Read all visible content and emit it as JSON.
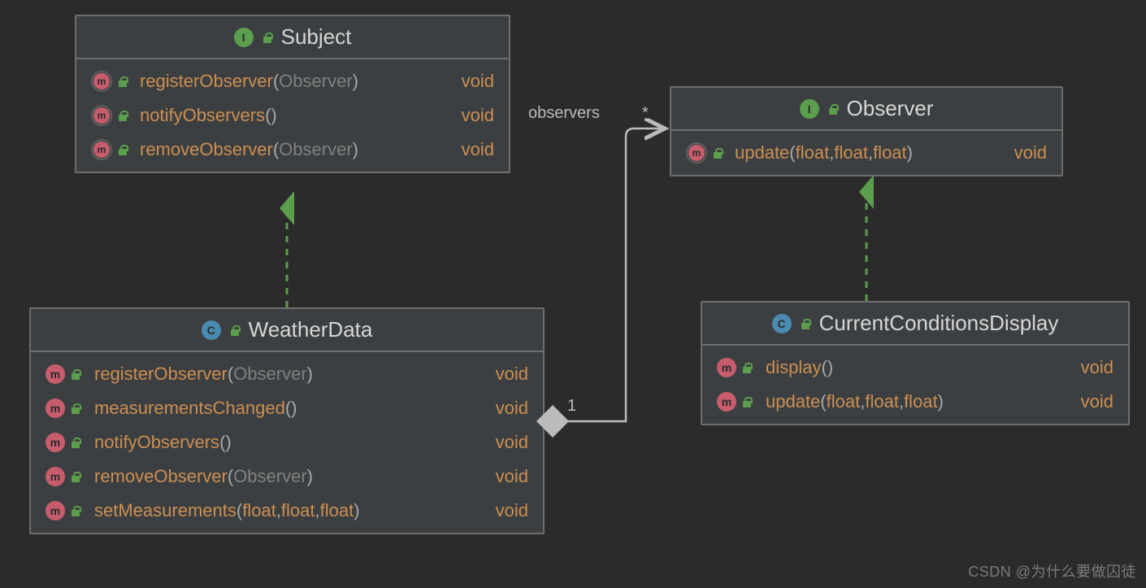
{
  "colors": {
    "bg": "#2b2b2b",
    "box": "#3c3f41",
    "border": "#6e6e6e",
    "name": "#cc8f52",
    "paramObj": "#808080",
    "ret": "#cc8f52",
    "interfaceIcon": "#5b9e4d",
    "classIcon": "#4a8ab0",
    "methodIcon": "#c75d6c",
    "arrowGreen": "#5b9e4d",
    "edgeGray": "#bbbbbb"
  },
  "subject": {
    "title": "Subject",
    "kind": "interface",
    "methods": [
      {
        "name": "registerObserver",
        "params": [
          {
            "t": "Observer",
            "style": "obj"
          }
        ],
        "ret": "void",
        "abstract": true
      },
      {
        "name": "notifyObservers",
        "params": [],
        "ret": "void",
        "abstract": true
      },
      {
        "name": "removeObserver",
        "params": [
          {
            "t": "Observer",
            "style": "obj"
          }
        ],
        "ret": "void",
        "abstract": true
      }
    ]
  },
  "observer": {
    "title": "Observer",
    "kind": "interface",
    "methods": [
      {
        "name": "update",
        "params": [
          {
            "t": "float",
            "style": "prim"
          },
          {
            "t": "float",
            "style": "prim"
          },
          {
            "t": "float",
            "style": "prim"
          }
        ],
        "ret": "void",
        "abstract": true
      }
    ]
  },
  "weatherData": {
    "title": "WeatherData",
    "kind": "class",
    "methods": [
      {
        "name": "registerObserver",
        "params": [
          {
            "t": "Observer",
            "style": "obj"
          }
        ],
        "ret": "void",
        "abstract": false
      },
      {
        "name": "measurementsChanged",
        "params": [],
        "ret": "void",
        "abstract": false
      },
      {
        "name": "notifyObservers",
        "params": [],
        "ret": "void",
        "abstract": false
      },
      {
        "name": "removeObserver",
        "params": [
          {
            "t": "Observer",
            "style": "obj"
          }
        ],
        "ret": "void",
        "abstract": false
      },
      {
        "name": "setMeasurements",
        "params": [
          {
            "t": "float",
            "style": "prim"
          },
          {
            "t": "float",
            "style": "prim"
          },
          {
            "t": "float",
            "style": "prim"
          }
        ],
        "ret": "void",
        "abstract": false
      }
    ]
  },
  "currentConditions": {
    "title": "CurrentConditionsDisplay",
    "kind": "class",
    "methods": [
      {
        "name": "display",
        "params": [],
        "ret": "void",
        "abstract": false
      },
      {
        "name": "update",
        "params": [
          {
            "t": "float",
            "style": "prim"
          },
          {
            "t": "float",
            "style": "prim"
          },
          {
            "t": "float",
            "style": "prim"
          }
        ],
        "ret": "void",
        "abstract": false
      }
    ]
  },
  "edges": {
    "association": {
      "label": "observers",
      "sourceMult": "1",
      "targetMult": "*"
    }
  },
  "watermark": "CSDN @为什么要做囚徒",
  "icons": {
    "interface_letter": "I",
    "class_letter": "C",
    "method_letter": "m"
  }
}
